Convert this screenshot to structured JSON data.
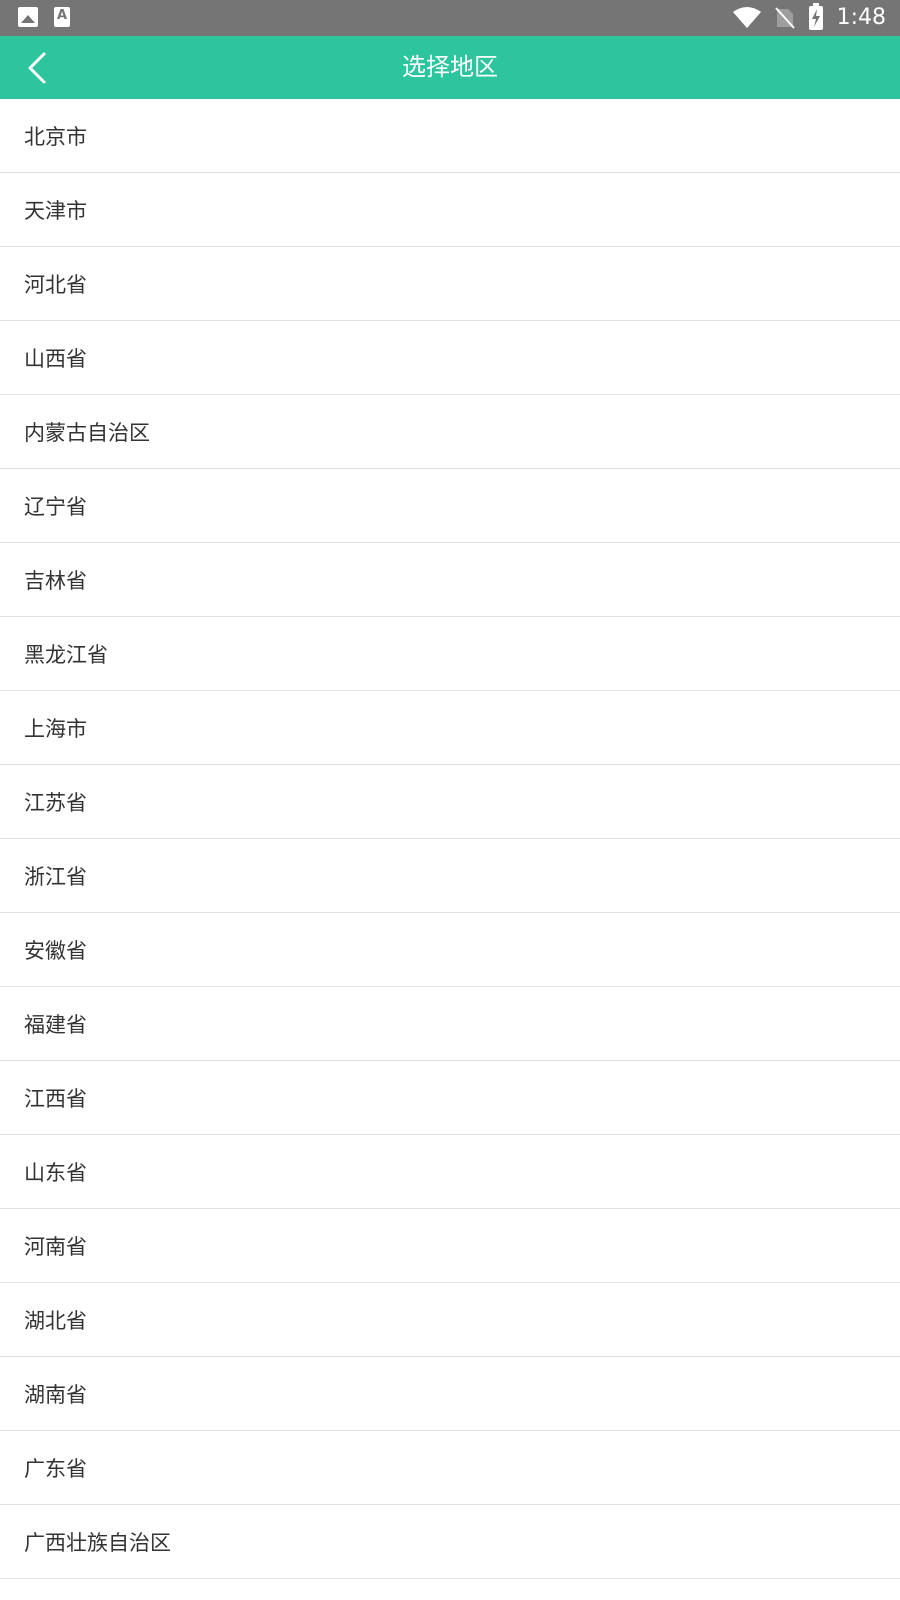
{
  "status_bar": {
    "time": "1:48",
    "left_icons": [
      "image-icon",
      "font-a-icon"
    ],
    "right_icons": [
      "wifi-icon",
      "no-sim-icon",
      "battery-charging-icon"
    ],
    "a_glyph": "A"
  },
  "toolbar": {
    "title": "选择地区",
    "back_icon": "chevron-left-icon",
    "color": "#2dc59e"
  },
  "regions": [
    "北京市",
    "天津市",
    "河北省",
    "山西省",
    "内蒙古自治区",
    "辽宁省",
    "吉林省",
    "黑龙江省",
    "上海市",
    "江苏省",
    "浙江省",
    "安徽省",
    "福建省",
    "江西省",
    "山东省",
    "河南省",
    "湖北省",
    "湖南省",
    "广东省",
    "广西壮族自治区"
  ]
}
